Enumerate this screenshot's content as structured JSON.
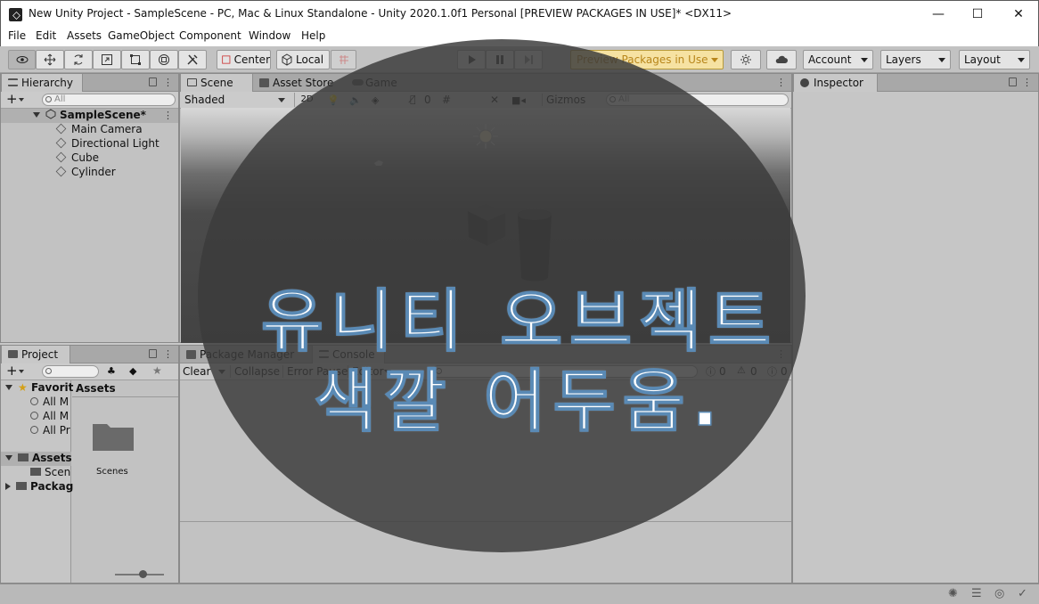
{
  "window": {
    "title": "New Unity Project - SampleScene - PC, Mac & Linux Standalone - Unity 2020.1.0f1 Personal [PREVIEW PACKAGES IN USE]* <DX11>",
    "minimize": "—",
    "maximize": "☐",
    "close": "✕"
  },
  "menu": [
    "File",
    "Edit",
    "Assets",
    "GameObject",
    "Component",
    "Window",
    "Help"
  ],
  "toolbar": {
    "center_label": "Center",
    "local_label": "Local",
    "preview_label": "Preview Packages in Use",
    "account_label": "Account",
    "layers_label": "Layers",
    "layout_label": "Layout"
  },
  "hierarchy": {
    "tab": "Hierarchy",
    "search_placeholder": "All",
    "scene_name": "SampleScene*",
    "items": [
      "Main Camera",
      "Directional Light",
      "Cube",
      "Cylinder"
    ]
  },
  "scene": {
    "tabs": [
      "Scene",
      "Asset Store",
      "Game"
    ],
    "shading": "Shaded",
    "mode_2d": "2D",
    "hidden_count": "0",
    "gizmos": "Gizmos",
    "search_placeholder": "All"
  },
  "inspector": {
    "tab": "Inspector"
  },
  "project": {
    "tab": "Project",
    "favorites_label": "Favorit",
    "favorites": [
      "All M",
      "All M",
      "All Pr"
    ],
    "assets_label": "Assets",
    "assets_children": [
      "Scen"
    ],
    "packages_label": "Packag",
    "breadcrumb": "Assets",
    "folder_name": "Scenes"
  },
  "console": {
    "tabs": [
      "Package Manager",
      "Console"
    ],
    "clear": "Clear",
    "collapse": "Collapse",
    "error_pause": "Error Pause",
    "editor": "Editor",
    "log_count": "0",
    "warn_count": "0",
    "error_count": "0"
  },
  "overlay_text": {
    "line1": "유니티 오브젝트",
    "line2": "색깔 어두움."
  },
  "colors": {
    "preview_accent": "#e8c96a",
    "overlay": "#3c3c3c"
  }
}
